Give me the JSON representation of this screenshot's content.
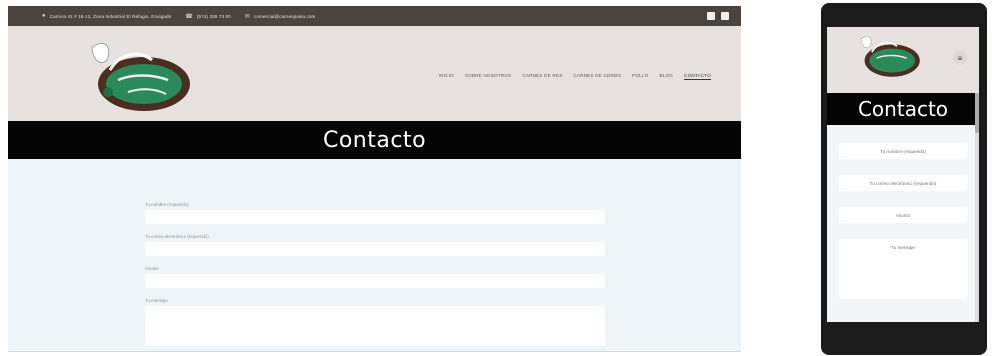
{
  "topbar": {
    "address": "Carrera 42 # 18-12, Zona Industrial El Refugio, Envigado",
    "phone": "(574) 339 73 00",
    "email": "comercial@carnespaisa.com",
    "social": [
      "facebook-icon",
      "instagram-icon"
    ]
  },
  "nav": {
    "items": [
      "INICIO",
      "SOBRE NOSOTROS",
      "CARNES DE RES",
      "CARNES DE CERDO",
      "POLLO",
      "BLOG",
      "CONTACTO"
    ],
    "active": "CONTACTO"
  },
  "banner": {
    "title": "Contacto"
  },
  "form": {
    "name_label": "Tu nombre (requerido)",
    "email_label": "Tu correo electrónico (requerido)",
    "subject_label": "Asunto",
    "message_label": "Tu mensaje"
  },
  "mobile": {
    "title": "Contacto",
    "name_placeholder": "Tu nombre (requerido)",
    "email_placeholder": "Tu correo electrónico (requerido)",
    "subject_placeholder": "Asunto",
    "message_placeholder": "Tu mensaje"
  },
  "colors": {
    "topbar": "#4a4340",
    "header": "#e7e2df",
    "banner": "#050505",
    "page": "#eef5f9",
    "brand_green": "#2a8a5a",
    "brand_brown": "#4b2e22"
  }
}
